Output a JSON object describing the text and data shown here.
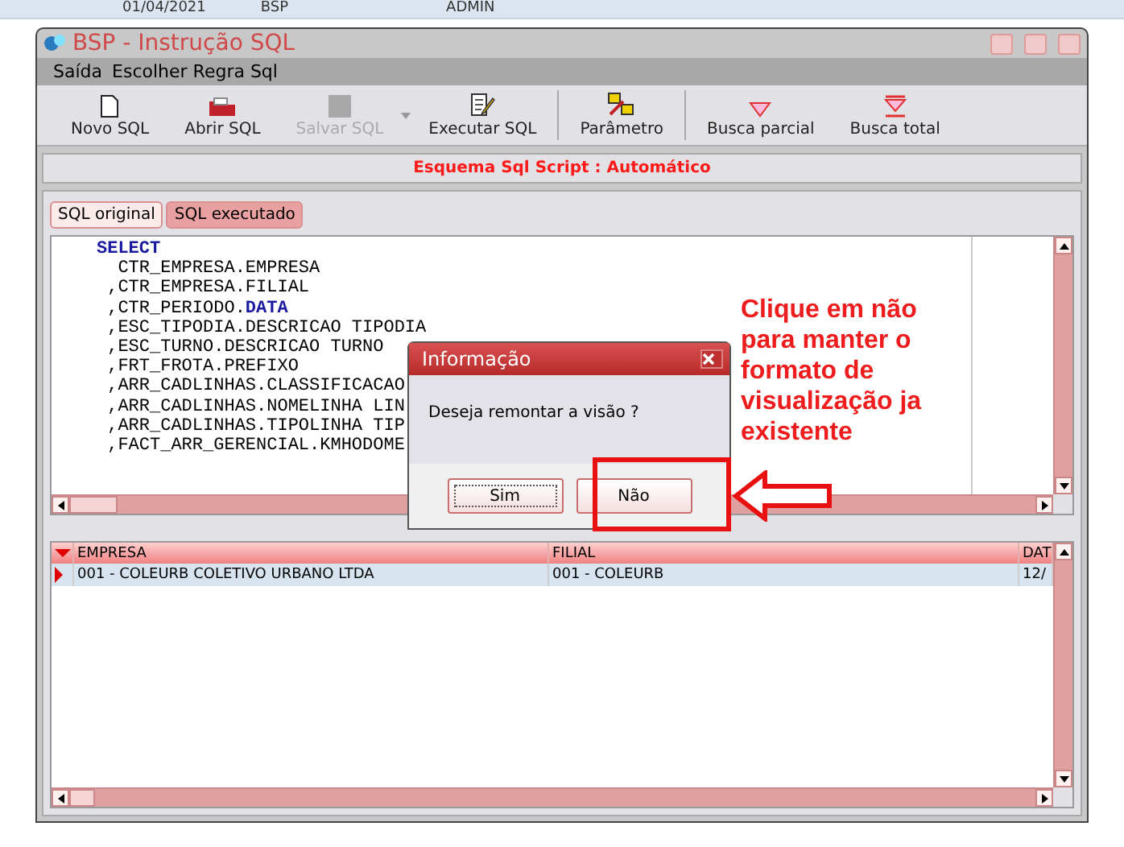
{
  "background_row": [
    "01/04/2021",
    "BSP",
    "ADMIN"
  ],
  "window": {
    "title": "BSP - Instrução SQL"
  },
  "menu": [
    "Saída",
    "Escolher Regra Sql"
  ],
  "toolbar": [
    {
      "label": "Novo SQL",
      "kind": "new",
      "disabled": false
    },
    {
      "label": "Abrir SQL",
      "kind": "open",
      "disabled": false
    },
    {
      "label": "Salvar SQL",
      "kind": "save",
      "disabled": true
    },
    {
      "label": "Executar SQL",
      "kind": "run",
      "disabled": false
    },
    {
      "label": "Parâmetro",
      "kind": "param",
      "disabled": false
    },
    {
      "label": "Busca parcial",
      "kind": "filter",
      "disabled": false
    },
    {
      "label": "Busca total",
      "kind": "filterall",
      "disabled": false
    }
  ],
  "schema_banner": "Esquema Sql Script : Automático",
  "tabs": [
    {
      "label": "SQL original",
      "selected": true
    },
    {
      "label": "SQL executado",
      "selected": false
    }
  ],
  "code_lines": [
    [
      {
        "text": "SELECT",
        "kind": "keyword"
      }
    ],
    [
      {
        "text": "  CTR_EMPRESA.EMPRESA",
        "kind": "plain"
      }
    ],
    [
      {
        "text": " ,CTR_EMPRESA.FILIAL",
        "kind": "plain"
      }
    ],
    [
      {
        "text": " ,CTR_PERIODO.",
        "kind": "plain"
      },
      {
        "text": "DATA",
        "kind": "keyword"
      }
    ],
    [
      {
        "text": " ,ESC_TIPODIA.DESCRICAO TIPODIA",
        "kind": "plain"
      }
    ],
    [
      {
        "text": " ,ESC_TURNO.DESCRICAO TURNO",
        "kind": "plain"
      }
    ],
    [
      {
        "text": " ,FRT_FROTA.PREFIXO",
        "kind": "plain"
      }
    ],
    [
      {
        "text": " ,ARR_CADLINHAS.CLASSIFICACAO",
        "kind": "plain"
      }
    ],
    [
      {
        "text": " ,ARR_CADLINHAS.NOMELINHA LIN",
        "kind": "plain"
      }
    ],
    [
      {
        "text": " ,ARR_CADLINHAS.TIPOLINHA TIP",
        "kind": "plain"
      }
    ],
    [
      {
        "text": " ,FACT_ARR_GERENCIAL.KMHODOME",
        "kind": "plain"
      }
    ]
  ],
  "grid": {
    "columns": [
      "EMPRESA",
      "FILIAL",
      "DAT"
    ],
    "rows": [
      {
        "cells": [
          "001 - COLEURB COLETIVO URBANO LTDA",
          "001 - COLEURB",
          "12/"
        ],
        "selected": true
      }
    ]
  },
  "dialog": {
    "title": "Informação",
    "message": "Deseja remontar a visão ?",
    "buttons": [
      {
        "label": "Sim",
        "focused": true
      },
      {
        "label": "Não",
        "focused": false
      }
    ]
  },
  "annotation": "Clique em não para manter o formato de visualização ja existente"
}
